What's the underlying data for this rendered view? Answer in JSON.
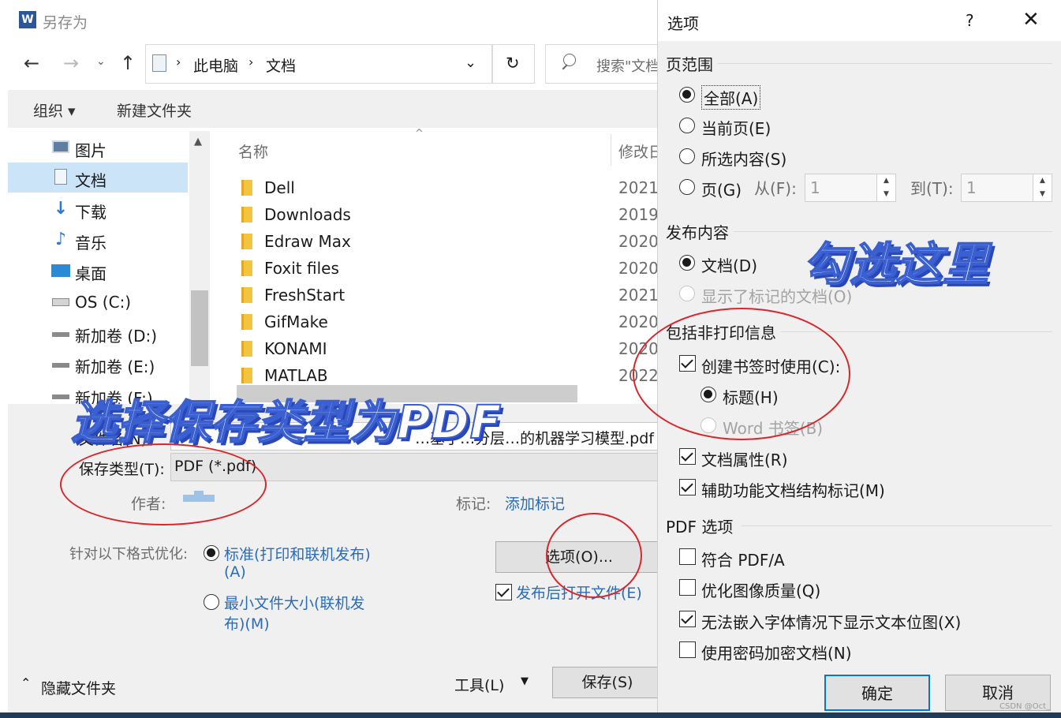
{
  "saveas": {
    "title": "另存为",
    "address": {
      "crumbs": [
        "此电脑",
        "文档"
      ]
    },
    "search": {
      "placeholder": "搜索\"文档\""
    },
    "toolbar": {
      "organize": "组织 ▾",
      "new_folder": "新建文件夹"
    },
    "sidebar": {
      "items": [
        {
          "label": "图片",
          "icon": "pictures-icon"
        },
        {
          "label": "文档",
          "icon": "documents-icon",
          "selected": true
        },
        {
          "label": "下载",
          "icon": "download-icon"
        },
        {
          "label": "音乐",
          "icon": "music-icon"
        },
        {
          "label": "桌面",
          "icon": "desktop-icon"
        },
        {
          "label": "OS (C:)",
          "icon": "drive-icon"
        },
        {
          "label": "新加卷 (D:)",
          "icon": "drive-icon"
        },
        {
          "label": "新加卷 (E:)",
          "icon": "drive-icon"
        },
        {
          "label": "新加卷 (F:)",
          "icon": "drive-icon"
        }
      ]
    },
    "columns": {
      "name": "名称",
      "modified": "修改日期"
    },
    "files": [
      {
        "name": "Dell",
        "date": "2021"
      },
      {
        "name": "Downloads",
        "date": "2019"
      },
      {
        "name": "Edraw Max",
        "date": "2020"
      },
      {
        "name": "Foxit files",
        "date": "2020"
      },
      {
        "name": "FreshStart",
        "date": "2021"
      },
      {
        "name": "GifMake",
        "date": "2020"
      },
      {
        "name": "KONAMI",
        "date": "2020"
      },
      {
        "name": "MATLAB",
        "date": "2022"
      }
    ],
    "filename": {
      "label": "文件名(N):",
      "value": "…基于…分层…的机器学习模型.pdf"
    },
    "filetype": {
      "label": "保存类型(T):",
      "value": "PDF (*.pdf)"
    },
    "author": {
      "label": "作者:"
    },
    "tags": {
      "label": "标记:",
      "link": "添加标记"
    },
    "optimize": {
      "label": "针对以下格式优化:",
      "standard_line1": "标准(打印和联机发布)",
      "standard_line2": "(A)",
      "min_line1": "最小文件大小(联机发",
      "min_line2": "布)(M)"
    },
    "options_button": "选项(O)...",
    "open_after": "发布后打开文件(E)",
    "hide_folders": "隐藏文件夹",
    "tools": "工具(L)",
    "save": "保存(S)"
  },
  "options_dialog": {
    "title": "选项",
    "help": "?",
    "page_range": {
      "heading": "页范围",
      "all": "全部(A)",
      "current": "当前页(E)",
      "selection": "所选内容(S)",
      "pages": "页(G)",
      "from_label": "从(F):",
      "from_value": "1",
      "to_label": "到(T):",
      "to_value": "1"
    },
    "publish": {
      "heading": "发布内容",
      "document": "文档(D)",
      "document_markup": "显示了标记的文档(O)"
    },
    "nonprint": {
      "heading": "包括非打印信息",
      "bookmarks": "创建书签时使用(C):",
      "headings": "标题(H)",
      "word_bookmarks": "Word 书签(B)",
      "doc_properties": "文档属性(R)",
      "accessibility": "辅助功能文档结构标记(M)"
    },
    "pdf": {
      "heading": "PDF 选项",
      "pdfa": "符合 PDF/A",
      "optimize_images": "优化图像质量(Q)",
      "bitmap_text": "无法嵌入字体情况下显示文本位图(X)",
      "encrypt": "使用密码加密文档(N)"
    },
    "ok": "确定",
    "cancel": "取消"
  },
  "annotations": {
    "select_pdf": "选择保存类型为PDF",
    "check_here": "勾选这里"
  },
  "watermark": "CSDN @Oct_"
}
